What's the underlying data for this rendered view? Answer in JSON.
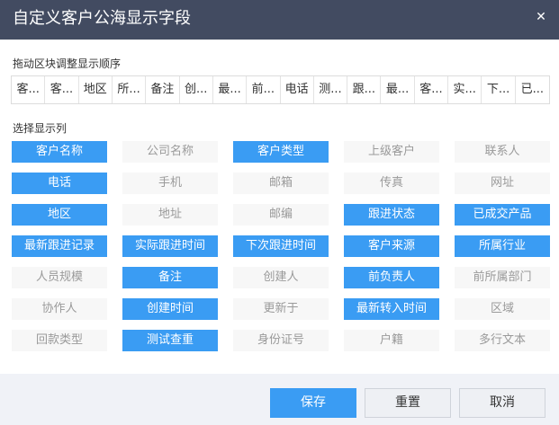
{
  "dialog": {
    "title": "自定义客户公海显示字段",
    "close_glyph": "✕"
  },
  "order_section": {
    "label": "拖动区块调整显示顺序",
    "items": [
      "客户名称",
      "客户类型",
      "地区",
      "所属行业",
      "备注",
      "创建时间",
      "最新跟进记录",
      "前负责人",
      "电话",
      "测试查重",
      "跟进状态",
      "最新转入时间",
      "客户来源",
      "实际跟进时间",
      "下次跟进时间",
      "已成交产品"
    ],
    "display": [
      "客...",
      "客...",
      "地区",
      "所...",
      "备注",
      "创...",
      "最...",
      "前...",
      "电话",
      "测...",
      "跟...",
      "最...",
      "客...",
      "实...",
      "下...",
      "已..."
    ]
  },
  "fields_section": {
    "label": "选择显示列",
    "fields": [
      {
        "label": "客户名称",
        "selected": true
      },
      {
        "label": "公司名称",
        "selected": false
      },
      {
        "label": "客户类型",
        "selected": true
      },
      {
        "label": "上级客户",
        "selected": false
      },
      {
        "label": "联系人",
        "selected": false
      },
      {
        "label": "电话",
        "selected": true
      },
      {
        "label": "手机",
        "selected": false
      },
      {
        "label": "邮箱",
        "selected": false
      },
      {
        "label": "传真",
        "selected": false
      },
      {
        "label": "网址",
        "selected": false
      },
      {
        "label": "地区",
        "selected": true
      },
      {
        "label": "地址",
        "selected": false
      },
      {
        "label": "邮编",
        "selected": false
      },
      {
        "label": "跟进状态",
        "selected": true
      },
      {
        "label": "已成交产品",
        "selected": true
      },
      {
        "label": "最新跟进记录",
        "selected": true
      },
      {
        "label": "实际跟进时间",
        "selected": true
      },
      {
        "label": "下次跟进时间",
        "selected": true
      },
      {
        "label": "客户来源",
        "selected": true
      },
      {
        "label": "所属行业",
        "selected": true
      },
      {
        "label": "人员规模",
        "selected": false
      },
      {
        "label": "备注",
        "selected": true
      },
      {
        "label": "创建人",
        "selected": false
      },
      {
        "label": "前负责人",
        "selected": true
      },
      {
        "label": "前所属部门",
        "selected": false
      },
      {
        "label": "协作人",
        "selected": false
      },
      {
        "label": "创建时间",
        "selected": true
      },
      {
        "label": "更新于",
        "selected": false
      },
      {
        "label": "最新转入时间",
        "selected": true
      },
      {
        "label": "区域",
        "selected": false
      },
      {
        "label": "回款类型",
        "selected": false
      },
      {
        "label": "测试查重",
        "selected": true
      },
      {
        "label": "身份证号",
        "selected": false
      },
      {
        "label": "户籍",
        "selected": false
      },
      {
        "label": "多行文本",
        "selected": false
      }
    ]
  },
  "footer": {
    "save_label": "保存",
    "reset_label": "重置",
    "cancel_label": "取消"
  },
  "colors": {
    "titlebar": "#424b61",
    "accent": "#3a9cf3",
    "unselected_bg": "#f7f7f7",
    "footer_bg": "#f0f2f7"
  }
}
